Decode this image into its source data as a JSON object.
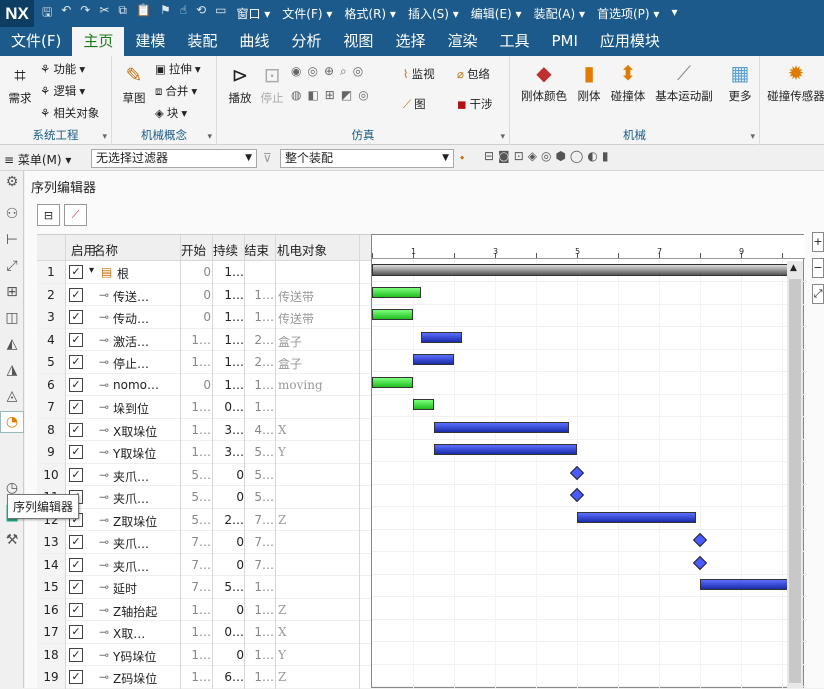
{
  "titlebar": {
    "logo": "NX",
    "menus": [
      "窗口 ▾",
      "文件(F) ▾",
      "格式(R) ▾",
      "插入(S) ▾",
      "编辑(E) ▾",
      "装配(A) ▾",
      "首选项(P) ▾",
      "▾"
    ]
  },
  "ribbon_tabs": [
    "文件(F)",
    "主页",
    "建模",
    "装配",
    "曲线",
    "分析",
    "视图",
    "选择",
    "渲染",
    "工具",
    "PMI",
    "应用模块"
  ],
  "groups": {
    "system": {
      "label": "系统工程",
      "need": "需求",
      "function": "功能",
      "logic": "逻辑",
      "related": "相关对象"
    },
    "mech_concept": {
      "label": "机械概念",
      "sketch": "草图",
      "extrude": "拉伸",
      "merge": "合并",
      "block": "块"
    },
    "sim": {
      "label": "仿真",
      "play": "播放",
      "stop": "停止",
      "monitor": "监视",
      "wrap": "包络",
      "graph": "图",
      "interfere": "干涉"
    },
    "mech": {
      "label": "机械",
      "rigid_color": "刚体颜色",
      "rigid": "刚体",
      "collider": "碰撞体",
      "motion_pair": "基本运动副",
      "more": "更多",
      "sensor": "碰撞传感器"
    }
  },
  "filterbar": {
    "menu": "菜单(M)",
    "filter": "无选择过滤器",
    "scope": "整个装配"
  },
  "tooltip": "序列编辑器",
  "panel": {
    "title": "序列编辑器"
  },
  "grid_header": {
    "enable": "启用",
    "name": "名称",
    "start": "开始",
    "duration": "持续",
    "end": "结束",
    "object": "机电对象"
  },
  "rows": [
    {
      "n": "1",
      "name": "根",
      "start": "0",
      "dur": "1…",
      "end": "",
      "obj": "",
      "tree": "root"
    },
    {
      "n": "2",
      "name": "传送…",
      "start": "0",
      "dur": "1…",
      "end": "1…",
      "obj": "传送带"
    },
    {
      "n": "3",
      "name": "传动…",
      "start": "0",
      "dur": "1…",
      "end": "1…",
      "obj": "传送带"
    },
    {
      "n": "4",
      "name": "激活…",
      "start": "1…",
      "dur": "1…",
      "end": "2…",
      "obj": "盒子"
    },
    {
      "n": "5",
      "name": "停止…",
      "start": "1…",
      "dur": "1…",
      "end": "2…",
      "obj": "盒子"
    },
    {
      "n": "6",
      "name": "nomo…",
      "start": "0",
      "dur": "1…",
      "end": "1…",
      "obj": "moving"
    },
    {
      "n": "7",
      "name": "垛到位",
      "start": "1…",
      "dur": "0…",
      "end": "1…",
      "obj": ""
    },
    {
      "n": "8",
      "name": "X取垛位",
      "start": "1…",
      "dur": "3…",
      "end": "4…",
      "obj": "X"
    },
    {
      "n": "9",
      "name": "Y取垛位",
      "start": "1…",
      "dur": "3…",
      "end": "5…",
      "obj": "Y"
    },
    {
      "n": "10",
      "name": "夹爪…",
      "start": "5…",
      "dur": "0",
      "end": "5…",
      "obj": ""
    },
    {
      "n": "11",
      "name": "夹爪…",
      "start": "5…",
      "dur": "0",
      "end": "5…",
      "obj": ""
    },
    {
      "n": "12",
      "name": "Z取垛位",
      "start": "5…",
      "dur": "2…",
      "end": "7…",
      "obj": "Z"
    },
    {
      "n": "13",
      "name": "夹爪…",
      "start": "7…",
      "dur": "0",
      "end": "7…",
      "obj": ""
    },
    {
      "n": "14",
      "name": "夹爪…",
      "start": "7…",
      "dur": "0",
      "end": "7…",
      "obj": ""
    },
    {
      "n": "15",
      "name": "延时",
      "start": "7…",
      "dur": "5…",
      "end": "1…",
      "obj": ""
    },
    {
      "n": "16",
      "name": "Z轴抬起",
      "start": "1…",
      "dur": "0",
      "end": "1…",
      "obj": "Z"
    },
    {
      "n": "17",
      "name": "X取…",
      "start": "1…",
      "dur": "0…",
      "end": "1…",
      "obj": "X"
    },
    {
      "n": "18",
      "name": "Y码垛位",
      "start": "1…",
      "dur": "0",
      "end": "1…",
      "obj": "Y"
    },
    {
      "n": "19",
      "name": "Z码垛位",
      "start": "1…",
      "dur": "6…",
      "end": "1…",
      "obj": "Z"
    }
  ],
  "timeline": {
    "ticks": [
      "1",
      "3",
      "5",
      "7",
      "9"
    ]
  },
  "gantt_bars": [
    {
      "row": 1,
      "kind": "root",
      "start": 0,
      "end": 10.5
    },
    {
      "row": 2,
      "kind": "green",
      "start": 0,
      "end": 1.2
    },
    {
      "row": 3,
      "kind": "green",
      "start": 0,
      "end": 1.0
    },
    {
      "row": 4,
      "kind": "blue",
      "start": 1.2,
      "end": 2.2
    },
    {
      "row": 5,
      "kind": "blue",
      "start": 1.0,
      "end": 2.0
    },
    {
      "row": 6,
      "kind": "green",
      "start": 0,
      "end": 1.0
    },
    {
      "row": 7,
      "kind": "green",
      "start": 1.0,
      "end": 1.5
    },
    {
      "row": 8,
      "kind": "blue",
      "start": 1.5,
      "end": 4.8
    },
    {
      "row": 9,
      "kind": "blue",
      "start": 1.5,
      "end": 5.0
    },
    {
      "row": 10,
      "kind": "diamond",
      "start": 5.0
    },
    {
      "row": 11,
      "kind": "diamond",
      "start": 5.0
    },
    {
      "row": 12,
      "kind": "blue",
      "start": 5.0,
      "end": 7.9
    },
    {
      "row": 13,
      "kind": "diamond",
      "start": 8.0
    },
    {
      "row": 14,
      "kind": "diamond",
      "start": 8.0
    },
    {
      "row": 15,
      "kind": "blue",
      "start": 8.0,
      "end": 10.5
    }
  ],
  "colors": {
    "titlebar": "#1b5a8a",
    "active_tab_text": "#1a7a1a",
    "group_label": "#1a5c88",
    "bar_green": "#1fbf1f",
    "bar_blue": "#1a2aa8"
  }
}
